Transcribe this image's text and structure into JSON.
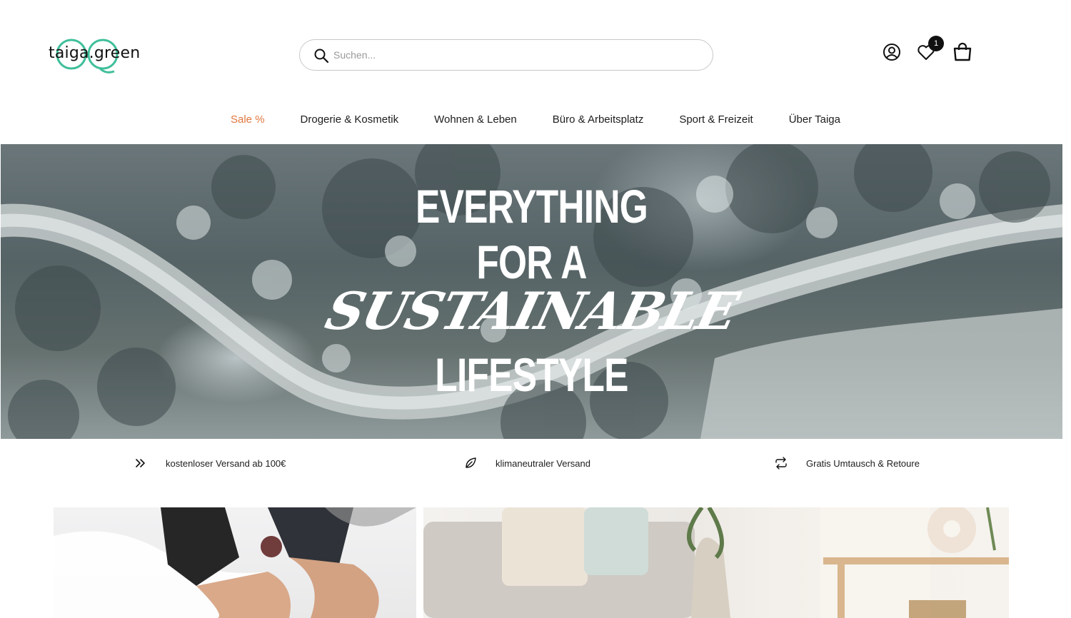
{
  "brand": {
    "logo_text": "taiga.green"
  },
  "search": {
    "placeholder": "Suchen..."
  },
  "header_icons": {
    "wishlist_count": "1"
  },
  "nav": {
    "items": [
      {
        "label": "Sale %"
      },
      {
        "label": "Drogerie & Kosmetik"
      },
      {
        "label": "Wohnen & Leben"
      },
      {
        "label": "Büro & Arbeitsplatz"
      },
      {
        "label": "Sport & Freizeit"
      },
      {
        "label": "Über Taiga"
      }
    ],
    "sale_color": "#e0773e"
  },
  "hero": {
    "line1": "EVERYTHING",
    "line2": "FOR A",
    "line3": "SUSTAINABLE",
    "line4": "LIFESTYLE"
  },
  "usps": [
    {
      "icon": "double-chevron-right-icon",
      "text": "kostenloser Versand ab 100€"
    },
    {
      "icon": "leaf-icon",
      "text": "klimaneutraler Versand"
    },
    {
      "icon": "exchange-arrows-icon",
      "text": "Gratis Umtausch & Retoure"
    }
  ],
  "colors": {
    "logo_accent": "#3fbf9a",
    "text": "#1d1d1d"
  }
}
